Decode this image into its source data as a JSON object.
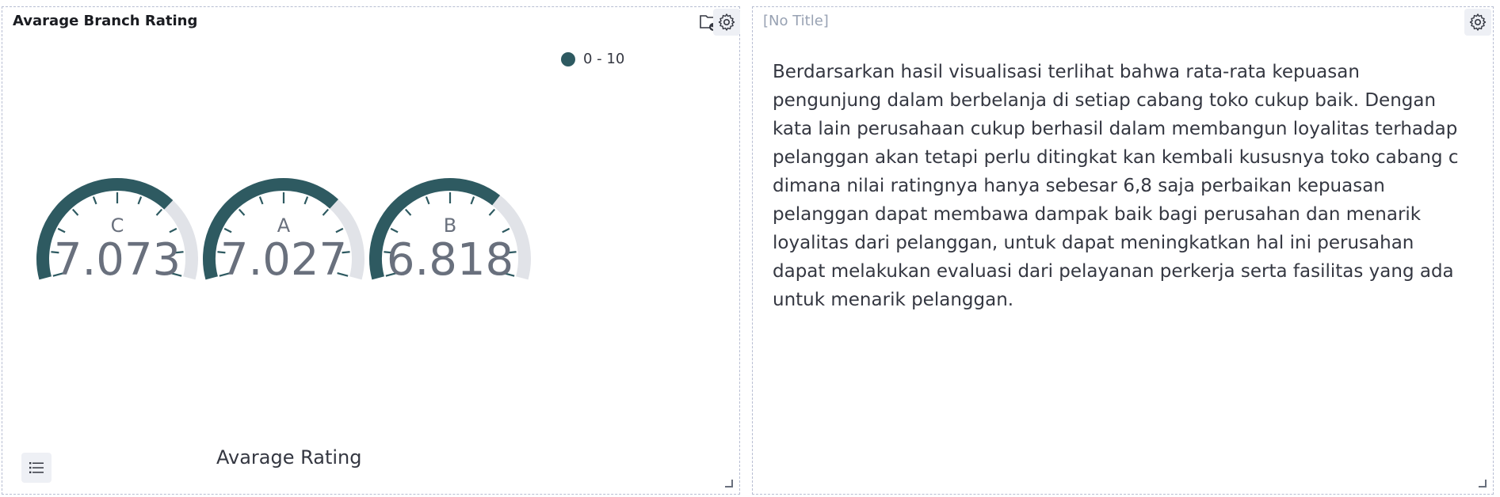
{
  "left_panel": {
    "title": "Avarage Branch Rating",
    "icons": [
      "folder-check-icon",
      "gear-icon",
      "list-icon"
    ]
  },
  "right_panel": {
    "title": "[No Title]",
    "body": "Berdarsarkan hasil visualisasi terlihat bahwa rata-rata kepuasan pengunjung dalam berbelanja di setiap cabang toko cukup baik. Dengan kata lain perusahaan cukup berhasil dalam membangun loyalitas terhadap pelanggan akan tetapi perlu ditingkat kan kembali kususnya toko cabang c dimana nilai ratingnya hanya sebesar 6,8 saja perbaikan kepuasan pelanggan dapat membawa dampak baik bagi perusahan dan menarik loyalitas dari pelanggan, untuk dapat meningkatkan hal ini perusahan dapat melakukan evaluasi dari pelayanan perkerja serta fasilitas yang ada untuk menarik pelanggan.",
    "icons": [
      "gear-icon"
    ]
  },
  "colors": {
    "gauge_fill": "#2e5a61",
    "gauge_track": "#e1e3e8",
    "text_muted": "#69707d"
  },
  "chart_data": {
    "type": "gauge",
    "categories": [
      "C",
      "A",
      "B"
    ],
    "values": [
      7.073,
      7.027,
      6.818
    ],
    "value_labels": [
      "7.073",
      "7.027",
      "6.818"
    ],
    "range": [
      0,
      10
    ],
    "legend": [
      "0 - 10"
    ],
    "legend_position": "top-right",
    "xlabel": "Avarage Rating"
  }
}
